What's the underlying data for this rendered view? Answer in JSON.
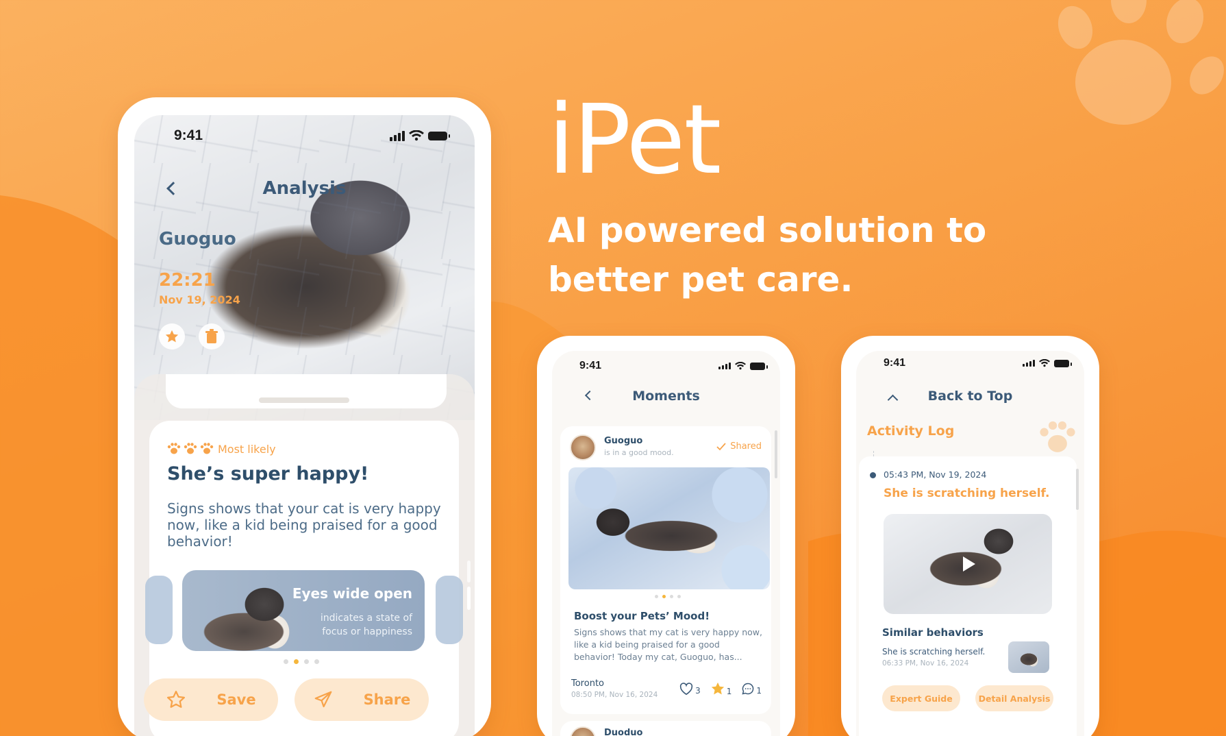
{
  "hero": {
    "brand": "iPet",
    "tagline": "AI powered solution to better pet care."
  },
  "colors": {
    "accent": "#f7a34a",
    "navy": "#2e4e6a",
    "background": "#f9a046",
    "pill": "#fde8cf"
  },
  "analysis_screen": {
    "status_time": "9:41",
    "title": "Analysis",
    "pet_name": "Guoguo",
    "time": "22:21",
    "date": "Nov 19, 2024",
    "likelihood": "Most likely",
    "headline": "She’s super happy!",
    "description": "Signs shows that your cat is very happy now, like a kid being praised for a good behavior!",
    "slide": {
      "title": "Eyes wide open",
      "subtitle": "indicates a state of focus or happiness"
    },
    "carousel_active": 2,
    "carousel_total": 4,
    "save_label": "Save",
    "share_label": "Share"
  },
  "moments_screen": {
    "status_time": "9:41",
    "title": "Moments",
    "post": {
      "author": "Guoguo",
      "mood": "is in a good mood.",
      "shared_label": "Shared",
      "title": "Boost your Pets’ Mood!",
      "body": "Signs shows that my cat is very happy now, like a kid being praised for a good behavior! Today my cat, Guoguo, has...",
      "location": "Toronto",
      "timestamp": "08:50 PM, Nov 16, 2024",
      "likes": "3",
      "stars": "1",
      "comments": "1"
    },
    "next_post_author": "Duoduo"
  },
  "activity_screen": {
    "status_time": "9:41",
    "title": "Back to Top",
    "section_title": "Activity Log",
    "entry": {
      "timestamp": "05:43 PM, Nov 19, 2024",
      "title": "She is scratching herself.",
      "similar_title": "Similar behaviors",
      "similar_text": "She is scratching herself.",
      "similar_date": "06:33 PM, Nov 16, 2024",
      "expert_label": "Expert Guide",
      "detail_label": "Detail Analysis"
    }
  }
}
